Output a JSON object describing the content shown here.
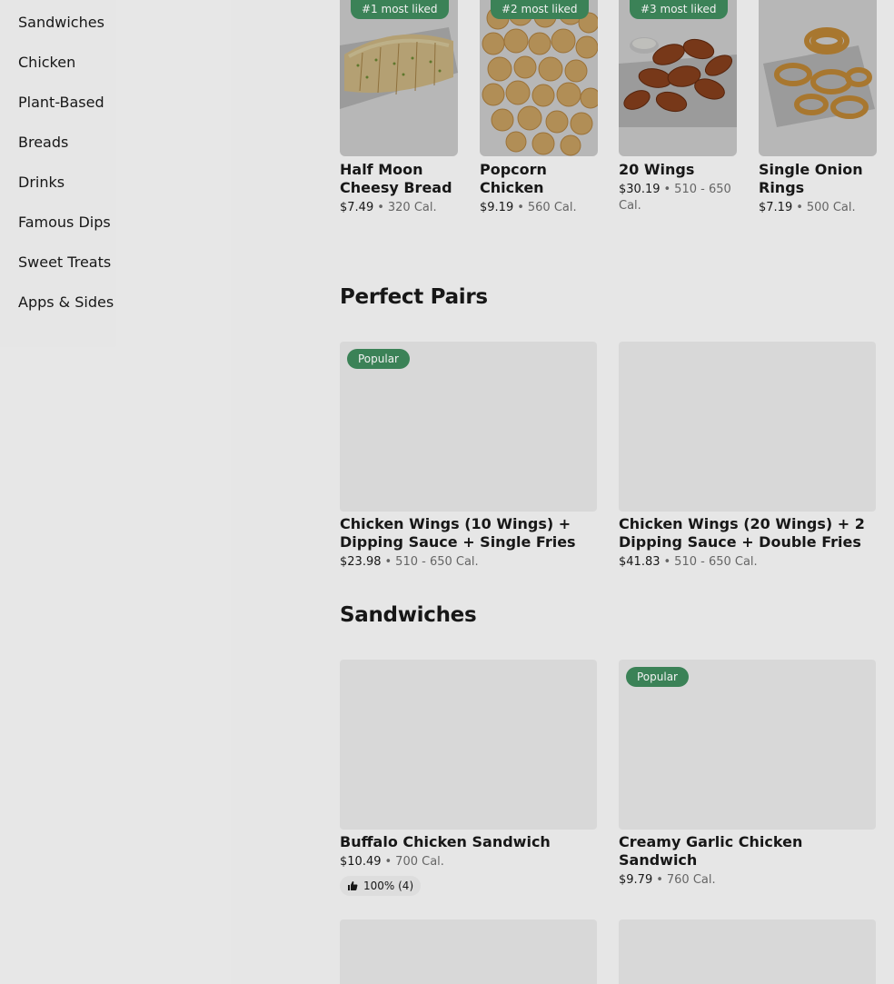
{
  "sidebar": {
    "items": [
      {
        "label": "Sandwiches"
      },
      {
        "label": "Chicken"
      },
      {
        "label": "Plant-Based"
      },
      {
        "label": "Breads"
      },
      {
        "label": "Drinks"
      },
      {
        "label": "Famous Dips"
      },
      {
        "label": "Sweet Treats"
      },
      {
        "label": "Apps & Sides"
      }
    ]
  },
  "most_liked": {
    "items": [
      {
        "badge": "#1 most liked",
        "name": "Half Moon Cheesy Bread",
        "price": "$7.49",
        "cal": "320 Cal.",
        "image_icon": "cheesy-bread-image"
      },
      {
        "badge": "#2 most liked",
        "name": "Popcorn Chicken",
        "price": "$9.19",
        "cal": "560 Cal.",
        "image_icon": "popcorn-chicken-image"
      },
      {
        "badge": "#3 most liked",
        "name": "20 Wings",
        "price": "$30.19",
        "cal": "510 - 650 Cal.",
        "image_icon": "wings-image"
      },
      {
        "badge": "",
        "name": "Single Onion Rings",
        "price": "$7.19",
        "cal": "500 Cal.",
        "image_icon": "onion-rings-image"
      }
    ]
  },
  "perfect_pairs": {
    "title": "Perfect Pairs",
    "items": [
      {
        "badge": "Popular",
        "name": "Chicken Wings (10 Wings) + Dipping Sauce + Single Fries",
        "price": "$23.98",
        "cal": "510 - 650 Cal."
      },
      {
        "badge": "",
        "name": "Chicken Wings (20 Wings) + 2 Dipping Sauce + Double Fries",
        "price": "$41.83",
        "cal": "510 - 650 Cal."
      }
    ]
  },
  "sandwiches": {
    "title": "Sandwiches",
    "items": [
      {
        "badge": "",
        "name": "Buffalo Chicken Sandwich",
        "price": "$10.49",
        "cal": "700 Cal.",
        "rating": "100% (4)"
      },
      {
        "badge": "Popular",
        "name": "Creamy Garlic Chicken Sandwich",
        "price": "$9.79",
        "cal": "760 Cal.",
        "rating": ""
      }
    ]
  },
  "colors": {
    "badge_green": "#3f8a5c",
    "overlay": "rgba(0,0,0,0.18)"
  }
}
